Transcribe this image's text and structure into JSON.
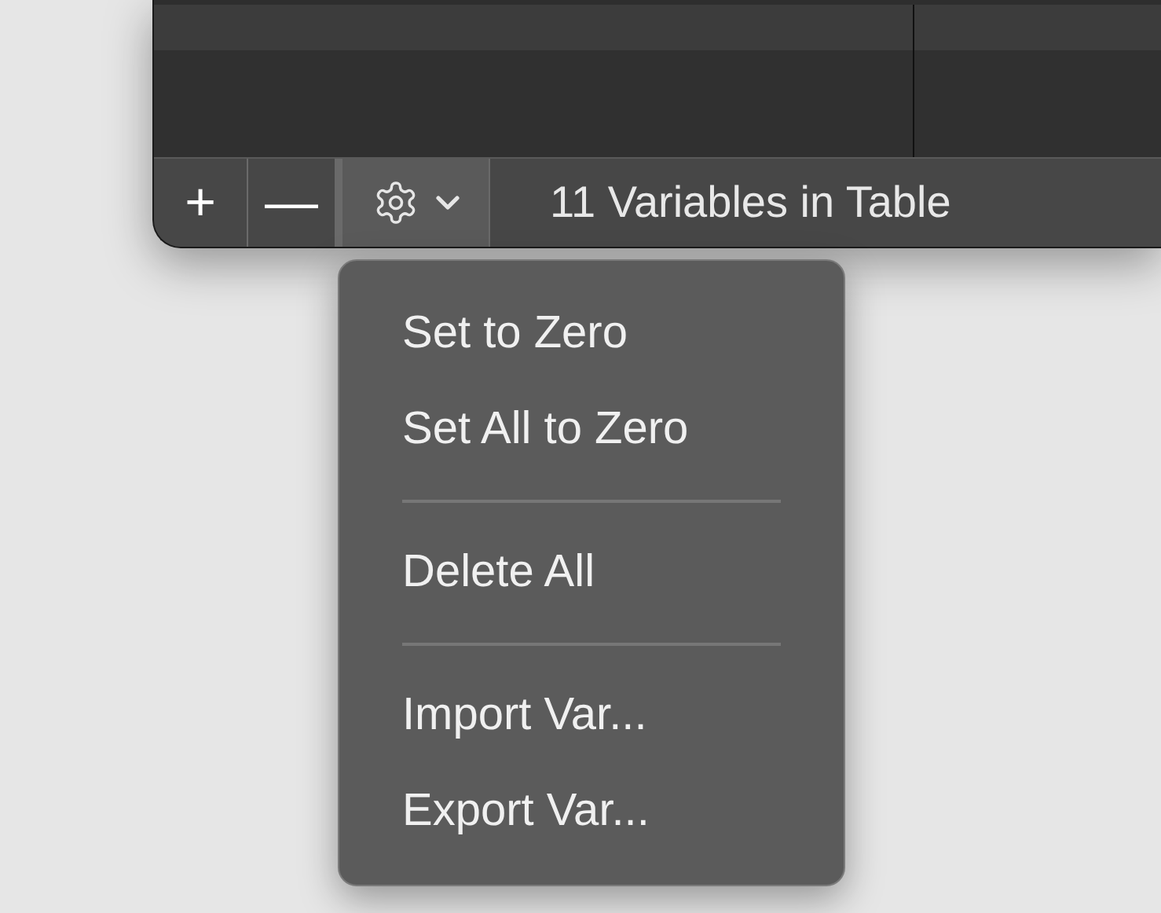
{
  "toolbar": {
    "buttons": [
      {
        "kind": "add",
        "label": "+"
      },
      {
        "kind": "remove",
        "label": "—"
      }
    ],
    "action_menu": {
      "expanded": true
    },
    "status": "11 Variables in Table"
  },
  "menu": {
    "items": [
      {
        "kind": "item",
        "label": "Set to Zero"
      },
      {
        "kind": "item",
        "label": "Set All to Zero"
      },
      {
        "kind": "separator"
      },
      {
        "kind": "item",
        "label": "Delete All"
      },
      {
        "kind": "separator"
      },
      {
        "kind": "item",
        "label": "Import Var..."
      },
      {
        "kind": "item",
        "label": "Export Var..."
      }
    ]
  }
}
